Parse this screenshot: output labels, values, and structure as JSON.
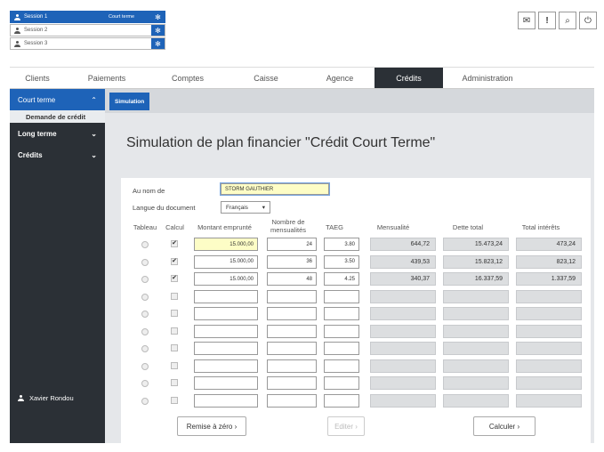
{
  "sessions": [
    {
      "name": "Session 1",
      "sub": "Court terme",
      "active": true
    },
    {
      "name": "Session 2",
      "sub": "",
      "active": false
    },
    {
      "name": "Session 3",
      "sub": "",
      "active": false
    }
  ],
  "topicons": {
    "mail": "✉",
    "alert": "!",
    "search": "⌕",
    "power": "⏻"
  },
  "nav": {
    "items": [
      "Clients",
      "Paiements",
      "Comptes",
      "Caisse",
      "Agence",
      "Crédits",
      "Administration"
    ],
    "active": "Crédits"
  },
  "sidebar": {
    "court_terme": "Court terme",
    "demande": "Demande de crédit",
    "long_terme": "Long terme",
    "credits": "Crédits",
    "user": "Xavier Rondou"
  },
  "tab": "Simulation",
  "title": "Simulation de plan financier \"Crédit Court Terme\"",
  "form": {
    "au_nom_label": "Au nom de",
    "au_nom_value": "STORM GAUTHIER",
    "langue_label": "Langue du document",
    "langue_value": "Français"
  },
  "table": {
    "headers": {
      "tableau": "Tableau",
      "calcul": "Calcul",
      "montant": "Montant emprunté",
      "nombre": "Nombre de mensualités",
      "taeg": "TAEG",
      "mensualite": "Mensualité",
      "dette": "Dette total",
      "interets": "Total intérêts"
    },
    "rows": [
      {
        "checked": true,
        "montant": "15.000,00",
        "nombre": "24",
        "taeg": "3.80",
        "mensualite": "644,72",
        "dette": "15.473,24",
        "interets": "473,24"
      },
      {
        "checked": true,
        "montant": "15.000,00",
        "nombre": "36",
        "taeg": "3.50",
        "mensualite": "439,53",
        "dette": "15.823,12",
        "interets": "823,12"
      },
      {
        "checked": true,
        "montant": "15.000,00",
        "nombre": "48",
        "taeg": "4.25",
        "mensualite": "340,37",
        "dette": "16.337,59",
        "interets": "1.337,59"
      },
      {
        "checked": false,
        "montant": "",
        "nombre": "",
        "taeg": "",
        "mensualite": "",
        "dette": "",
        "interets": ""
      },
      {
        "checked": false,
        "montant": "",
        "nombre": "",
        "taeg": "",
        "mensualite": "",
        "dette": "",
        "interets": ""
      },
      {
        "checked": false,
        "montant": "",
        "nombre": "",
        "taeg": "",
        "mensualite": "",
        "dette": "",
        "interets": ""
      },
      {
        "checked": false,
        "montant": "",
        "nombre": "",
        "taeg": "",
        "mensualite": "",
        "dette": "",
        "interets": ""
      },
      {
        "checked": false,
        "montant": "",
        "nombre": "",
        "taeg": "",
        "mensualite": "",
        "dette": "",
        "interets": ""
      },
      {
        "checked": false,
        "montant": "",
        "nombre": "",
        "taeg": "",
        "mensualite": "",
        "dette": "",
        "interets": ""
      },
      {
        "checked": false,
        "montant": "",
        "nombre": "",
        "taeg": "",
        "mensualite": "",
        "dette": "",
        "interets": ""
      }
    ]
  },
  "buttons": {
    "reset": "Remise à zéro ›",
    "edit": "Editer ›",
    "calc": "Calculer ›"
  },
  "colors": {
    "accent": "#1e63b8",
    "dark": "#2b3036"
  }
}
